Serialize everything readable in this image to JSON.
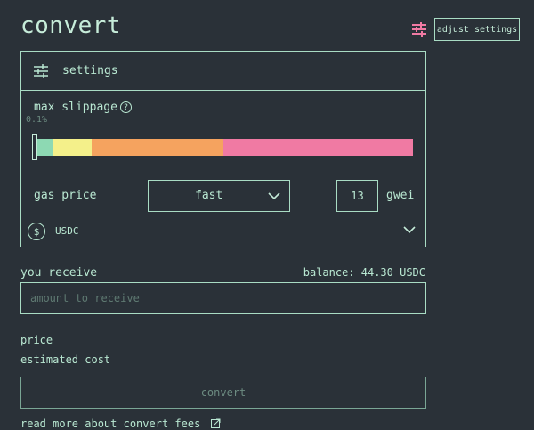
{
  "page": {
    "title": "convert"
  },
  "header": {
    "adjust_icon": "sliders-icon",
    "adjust_label": "adjust settings"
  },
  "settings": {
    "icon": "sliders-icon",
    "label": "settings",
    "slippage": {
      "label": "max slippage",
      "help_icon": "question-circle-icon",
      "help_glyph": "?",
      "value": "0.1%",
      "segment_colors": [
        "#8dd9b3",
        "#f4f08a",
        "#f5a35f",
        "#f07aa3"
      ]
    },
    "gas": {
      "label": "gas price",
      "selected": "fast",
      "amount": "13",
      "unit": "gwei"
    }
  },
  "token": {
    "icon": "dollar-coin-icon",
    "icon_glyph": "$",
    "symbol": "USDC"
  },
  "receive": {
    "label": "you receive",
    "balance": "balance: 44.30 USDC",
    "placeholder": "amount to receive"
  },
  "summary": {
    "price_label": "price",
    "estimated_cost_label": "estimated cost"
  },
  "actions": {
    "convert_label": "convert"
  },
  "footer": {
    "fees_link": "read more about convert fees",
    "link_icon": "external-link-icon"
  },
  "colors": {
    "background": "#2a3138",
    "accent": "#b9e8d2",
    "icon_pink": "#f07aa3"
  }
}
